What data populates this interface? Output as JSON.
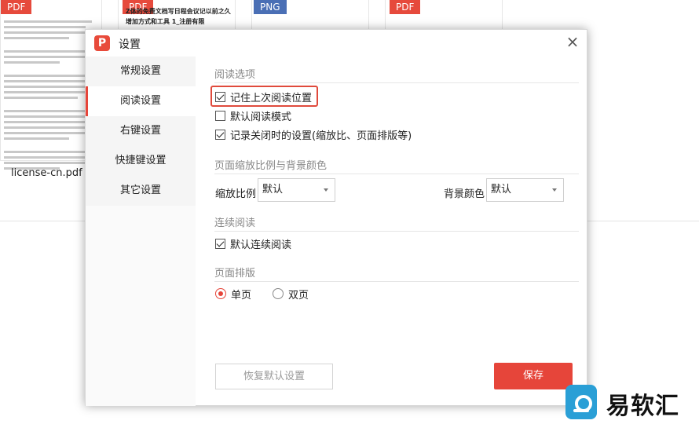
{
  "background": {
    "thumbnails": [
      {
        "badge": "PDF",
        "kind": "pdf"
      },
      {
        "badge": "PDF",
        "kind": "pdf",
        "title": "Z体的免费文档写日程会议记以前之久增加方式和工具 1_注册有限"
      },
      {
        "badge": "PNG",
        "kind": "png"
      },
      {
        "badge": "PDF",
        "kind": "pdf"
      }
    ],
    "file_label": "license-cn.pdf"
  },
  "dialog": {
    "title": "设置",
    "logo": "P",
    "close_symbol": "×",
    "nav": [
      {
        "label": "常规设置",
        "active": false
      },
      {
        "label": "阅读设置",
        "active": true
      },
      {
        "label": "右键设置",
        "active": false
      },
      {
        "label": "快捷键设置",
        "active": false
      },
      {
        "label": "其它设置",
        "active": false
      }
    ],
    "reading": {
      "section_title": "阅读选项",
      "options": [
        {
          "label": "记住上次阅读位置",
          "checked": true
        },
        {
          "label": "默认阅读模式",
          "checked": false
        },
        {
          "label": "记录关闭时的设置(缩放比、页面排版等)",
          "checked": true
        }
      ]
    },
    "zoom": {
      "section_title": "页面缩放比例与背景颜色",
      "zoom_label": "缩放比例",
      "zoom_value": "默认",
      "bg_label": "背景颜色",
      "bg_value": "默认"
    },
    "continuous": {
      "section_title": "连续阅读",
      "option": {
        "label": "默认连续阅读",
        "checked": true
      }
    },
    "layout": {
      "section_title": "页面排版",
      "single": "单页",
      "double": "双页",
      "selected": "single"
    },
    "buttons": {
      "reset": "恢复默认设置",
      "save": "保存"
    },
    "accent_color": "#e6453a"
  },
  "watermark": {
    "text": "易软汇"
  }
}
